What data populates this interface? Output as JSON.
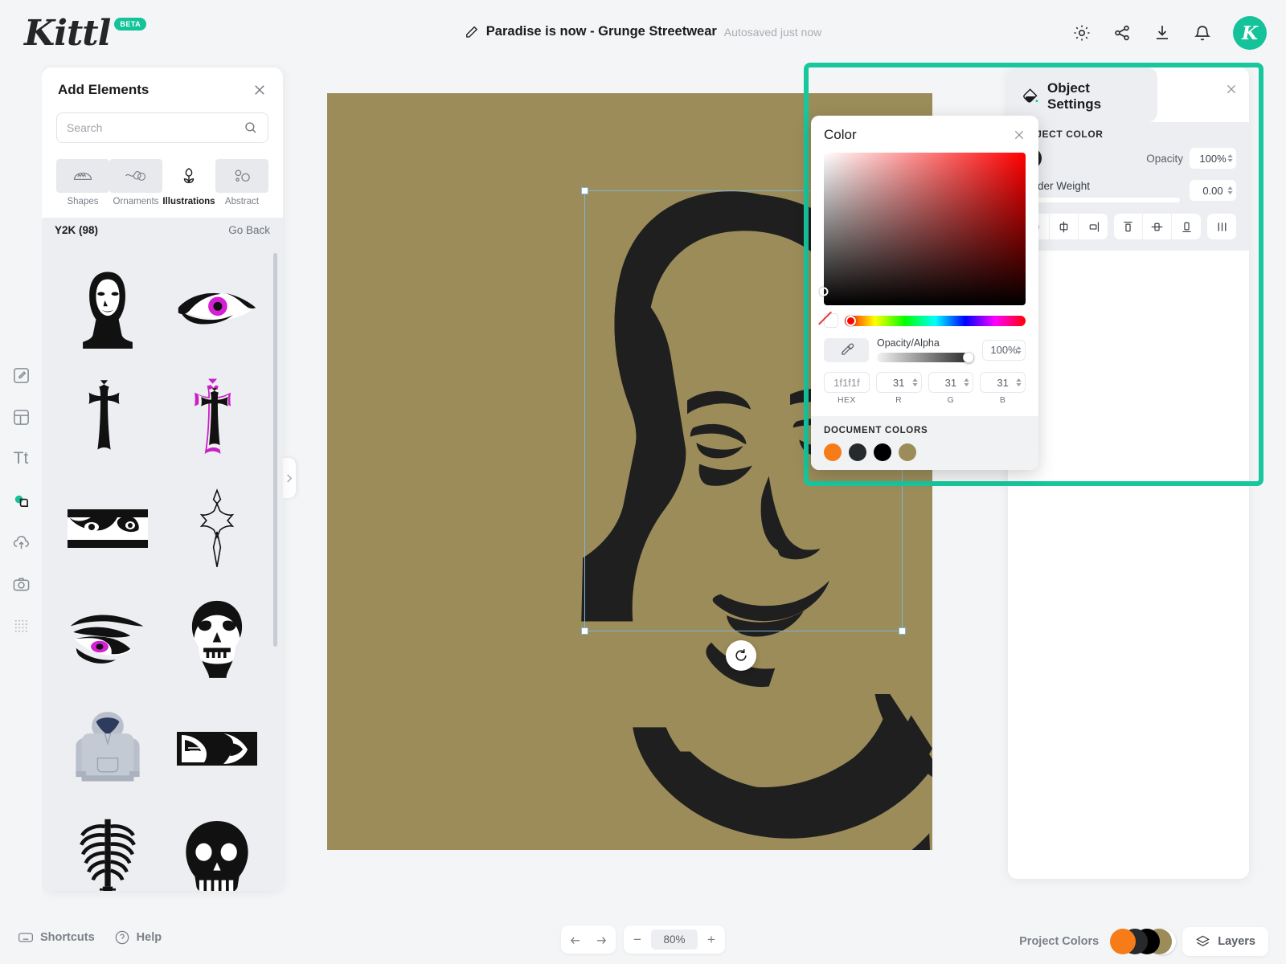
{
  "app": {
    "brand": "Kittl",
    "brand_badge": "BETA",
    "accent_color": "#14c39a"
  },
  "header": {
    "doc_title": "Paradise is now - Grunge Streetwear",
    "autosave_status": "Autosaved just now",
    "icons": [
      "gear-icon",
      "share-icon",
      "download-icon",
      "bell-icon"
    ],
    "avatar_initial": "K"
  },
  "left_rail": {
    "items": [
      {
        "name": "design-tool",
        "icon": "pencil-square-icon"
      },
      {
        "name": "templates-tool",
        "icon": "layout-icon"
      },
      {
        "name": "text-tool",
        "icon": "text-icon"
      },
      {
        "name": "elements-tool",
        "icon": "shapes-icon",
        "active": true
      },
      {
        "name": "uploads-tool",
        "icon": "cloud-upload-icon"
      },
      {
        "name": "photos-tool",
        "icon": "camera-icon"
      },
      {
        "name": "mockups-tool",
        "icon": "grid-dots-icon"
      }
    ]
  },
  "add_elements": {
    "title": "Add Elements",
    "close_label": "×",
    "search": {
      "value": "",
      "placeholder": "Search"
    },
    "categories": [
      {
        "label": "Shapes",
        "icon": "shapes-icon",
        "active": false
      },
      {
        "label": "Ornaments",
        "icon": "ornament-swirl-icon",
        "active": false
      },
      {
        "label": "Illustrations",
        "icon": "tulip-icon",
        "active": true
      },
      {
        "label": "Abstract",
        "icon": "abstract-circles-icon",
        "active": false
      }
    ],
    "collection_title": "Y2K (98)",
    "go_back_label": "Go Back",
    "thumbnails": [
      {
        "name": "y2k-woman-face-stencil"
      },
      {
        "name": "y2k-magenta-eye"
      },
      {
        "name": "y2k-gothic-cross-solid"
      },
      {
        "name": "y2k-gothic-cross-magenta"
      },
      {
        "name": "y2k-eyes-strip"
      },
      {
        "name": "y2k-gothic-cross-outline"
      },
      {
        "name": "y2k-eye-magenta-iris"
      },
      {
        "name": "y2k-skull-head"
      },
      {
        "name": "y2k-grey-hoodie"
      },
      {
        "name": "y2k-mouth-strip"
      },
      {
        "name": "y2k-ribcage"
      },
      {
        "name": "y2k-skull-silhouette"
      }
    ]
  },
  "canvas": {
    "artboard_color": "#9b8c5a",
    "selected_object": "woman-face-stencil",
    "rotate_label": "↺"
  },
  "object_settings": {
    "title": "Object Settings",
    "section_label": "OBJECT COLOR",
    "object_color": "#1f1f1f",
    "opacity_label": "Opacity",
    "opacity_value": "100%",
    "border_weight_label": "Border Weight",
    "border_weight_value": "0.00",
    "align_buttons": [
      "align-left-icon",
      "align-center-horizontal-icon",
      "align-right-icon",
      "align-top-icon",
      "align-middle-vertical-icon",
      "align-bottom-icon",
      "distribute-icon"
    ]
  },
  "color_popover": {
    "title": "Color",
    "close_label": "×",
    "eyedropper_label": "eyedropper-icon",
    "opacity_alpha_label": "Opacity/Alpha",
    "opacity_alpha_value": "100%",
    "hex_value": "1f1f1f",
    "hex_caption": "HEX",
    "r_value": "31",
    "r_caption": "R",
    "g_value": "31",
    "g_caption": "G",
    "b_value": "31",
    "b_caption": "B",
    "document_colors_label": "DOCUMENT COLORS",
    "document_colors": [
      "#f57c18",
      "#262a2c",
      "#000000",
      "#9b8c5a"
    ]
  },
  "bottom_bar": {
    "shortcuts_label": "Shortcuts",
    "help_label": "Help",
    "undo_label": "undo-icon",
    "redo_label": "redo-icon",
    "zoom_out_label": "−",
    "zoom_value": "80%",
    "zoom_in_label": "+",
    "project_colors_label": "Project Colors",
    "project_colors": [
      "#f57c18",
      "#262a2c",
      "#000000",
      "#9b8c5a"
    ],
    "layers_label": "Layers"
  }
}
